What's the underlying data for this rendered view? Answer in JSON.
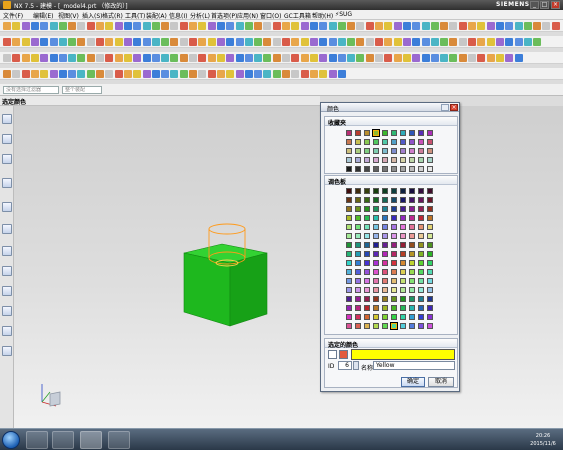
{
  "app": {
    "title": "NX 7.5 - 建模 - [_model4.prt （修改的）]",
    "brand": "SIEMENS"
  },
  "menu": [
    "文件(F)",
    "编辑(E)",
    "视图(V)",
    "插入(S)",
    "格式(R)",
    "工具(T)",
    "装配(A)",
    "信息(I)",
    "分析(L)",
    "首选项(P)",
    "应用(N)",
    "窗口(O)",
    "GC工具箱",
    "帮助(H)",
    "⚡SUG"
  ],
  "selection_bar": {
    "filter_value": "没有选择过滤器",
    "scope_value": "整个装配"
  },
  "resource_bar_title": "选定颜色",
  "dialog": {
    "title": "颜色",
    "favorites_header": "收藏夹",
    "palette_header": "调色板",
    "selected_header": "选定的颜色",
    "selected_color": "#ffff00",
    "id_label": "ID",
    "id_value": "6",
    "name_label": "名称",
    "name_value": "Yellow",
    "ok_label": "确定",
    "cancel_label": "取消"
  },
  "taskbar": {
    "time": "20:26",
    "date": "2015/11/6"
  },
  "icons": [
    "start-orb-icon",
    "explorer-icon",
    "nx-icon",
    "media-icon"
  ],
  "colors": {
    "cube": "#1db81d",
    "cylinder": "#ff9a1a",
    "selected": "#ffff00"
  }
}
